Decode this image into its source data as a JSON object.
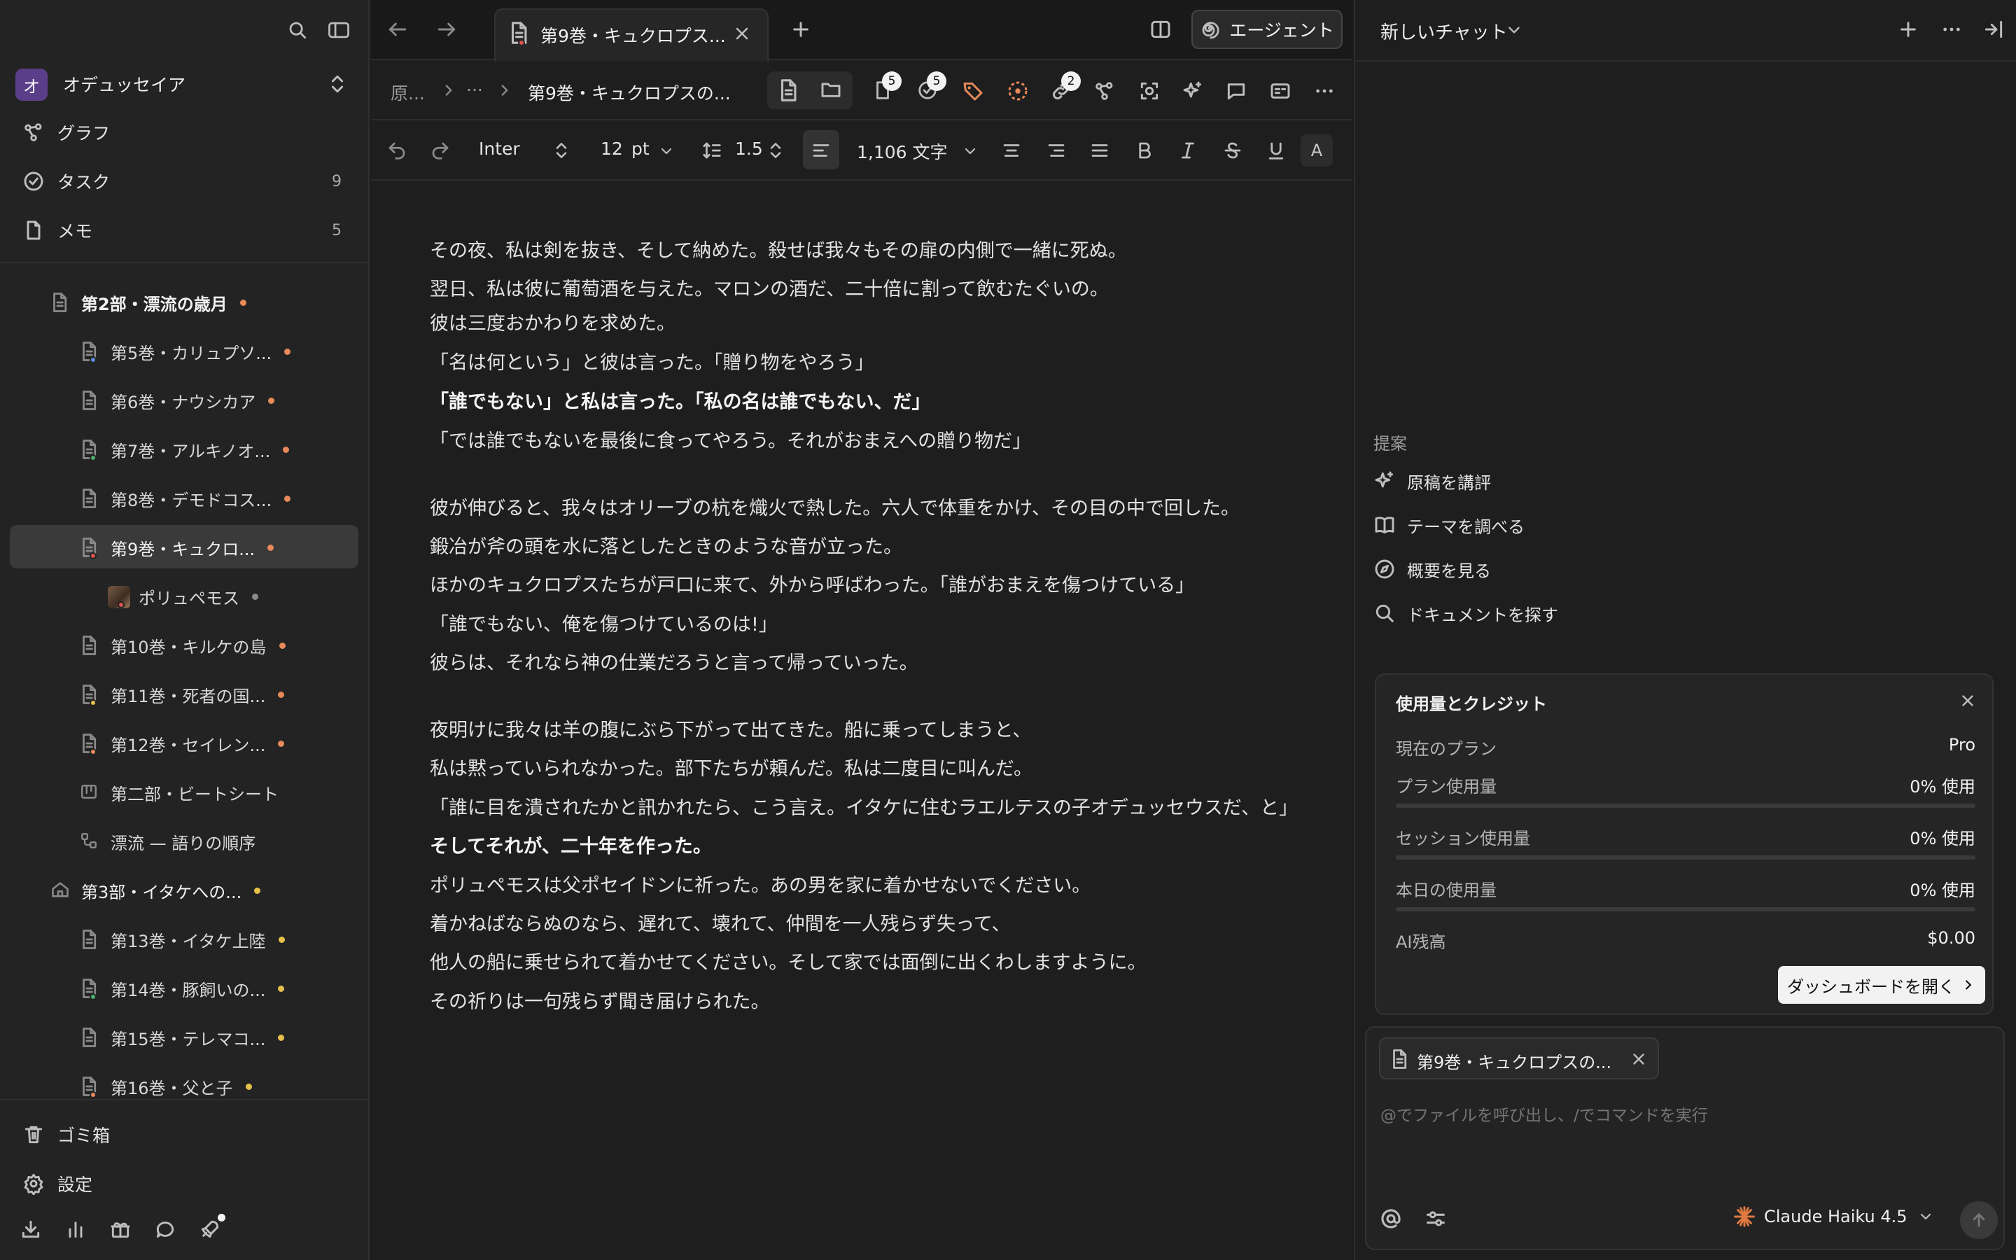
{
  "sidebar": {
    "workspace_initial": "オ",
    "workspace_name": "オデュッセイア",
    "nav": [
      {
        "label": "グラフ",
        "icon": "graph-icon",
        "count": ""
      },
      {
        "label": "タスク",
        "icon": "check-circle-icon",
        "count": "9"
      },
      {
        "label": "メモ",
        "icon": "note-icon",
        "count": "5"
      }
    ],
    "tree": [
      {
        "label": "第2部・漂流の歳月",
        "indent": 1,
        "icon": "document-icon",
        "dot": "#e8895a",
        "sub": ""
      },
      {
        "label": "第5巻・カリュプソ...",
        "indent": 2,
        "icon": "document-icon",
        "dot": "#e8895a",
        "sub": "#5b8bd9"
      },
      {
        "label": "第6巻・ナウシカア",
        "indent": 2,
        "icon": "document-icon",
        "dot": "#e8895a",
        "sub": ""
      },
      {
        "label": "第7巻・アルキノオ...",
        "indent": 2,
        "icon": "document-icon",
        "dot": "#e8895a",
        "sub": "#4caf6a"
      },
      {
        "label": "第8巻・デモドコス...",
        "indent": 2,
        "icon": "document-icon",
        "dot": "#e8895a",
        "sub": ""
      },
      {
        "label": "第9巻・キュクロ...",
        "indent": 2,
        "icon": "document-icon",
        "dot": "#e8895a",
        "sub": "#d9534f",
        "selected": true
      },
      {
        "label": "ポリュペモス",
        "indent": 3,
        "icon": "avatar-icon",
        "dot": "#8a8a8a",
        "sub": "#d9534f"
      },
      {
        "label": "第10巻・キルケの島",
        "indent": 2,
        "icon": "document-icon",
        "dot": "#e8895a",
        "sub": ""
      },
      {
        "label": "第11巻・死者の国...",
        "indent": 2,
        "icon": "document-icon",
        "dot": "#e8895a",
        "sub": "#e6c04a"
      },
      {
        "label": "第12巻・セイレン...",
        "indent": 2,
        "icon": "document-icon",
        "dot": "#e8895a",
        "sub": "#e8895a"
      },
      {
        "label": "第二部・ビートシート",
        "indent": 2,
        "icon": "board-icon",
        "dot": "",
        "sub": ""
      },
      {
        "label": "漂流 — 語りの順序",
        "indent": 2,
        "icon": "flow-icon",
        "dot": "",
        "sub": ""
      },
      {
        "label": "第3部・イタケへの...",
        "indent": 1,
        "icon": "home-icon",
        "dot": "#e6c04a",
        "sub": ""
      },
      {
        "label": "第13巻・イタケ上陸",
        "indent": 2,
        "icon": "document-icon",
        "dot": "#e6c04a",
        "sub": ""
      },
      {
        "label": "第14巻・豚飼いの...",
        "indent": 2,
        "icon": "document-icon",
        "dot": "#e6c04a",
        "sub": "#4caf6a"
      },
      {
        "label": "第15巻・テレマコ...",
        "indent": 2,
        "icon": "document-icon",
        "dot": "#e6c04a",
        "sub": ""
      },
      {
        "label": "第16巻・父と子",
        "indent": 2,
        "icon": "document-icon",
        "dot": "#e6c04a",
        "sub": "#e8895a"
      }
    ],
    "footer": [
      {
        "label": "ゴミ箱",
        "icon": "trash-icon"
      },
      {
        "label": "設定",
        "icon": "gear-icon"
      }
    ]
  },
  "editor": {
    "tab_title": "第9巻・キュクロプス...",
    "agent_label": "エージェント",
    "breadcrumb": {
      "root": "原...",
      "ellipsis": "···",
      "current": "第9巻・キュクロプスの..."
    },
    "badges": {
      "files": "5",
      "tasks": "5",
      "links": "2"
    },
    "format": {
      "font": "Inter",
      "size": "12",
      "unit": "pt",
      "line_height": "1.5",
      "word_count": "1,106 文字"
    },
    "paragraphs": [
      {
        "text": "その夜、私は剣を抜き、そして納めた。殺せば我々もその扉の内側で一緒に死ぬ。",
        "bold": false
      },
      {
        "text": "翌日、私は彼に葡萄酒を与えた。マロンの酒だ、二十倍に割って飲むたぐいの。",
        "bold": false
      },
      {
        "text": "彼は三度おかわりを求めた。",
        "bold": false
      },
      {
        "text": "「名は何という」と彼は言った。「贈り物をやろう」",
        "bold": false
      },
      {
        "text": "「誰でもない」と私は言った。「私の名は誰でもない、だ」",
        "bold": true
      },
      {
        "text": "「では誰でもないを最後に食ってやろう。それがおまえへの贈り物だ」",
        "bold": false
      },
      {
        "text": "彼が伸びると、我々はオリーブの杭を熾火で熱した。六人で体重をかけ、その目の中で回した。",
        "bold": false
      },
      {
        "text": "鍛冶が斧の頭を水に落としたときのような音が立った。",
        "bold": false
      },
      {
        "text": "ほかのキュクロプスたちが戸口に来て、外から呼ばわった。「誰がおまえを傷つけている」",
        "bold": false
      },
      {
        "text": "「誰でもない、俺を傷つけているのは!」",
        "bold": false
      },
      {
        "text": "彼らは、それなら神の仕業だろうと言って帰っていった。",
        "bold": false
      },
      {
        "text": "夜明けに我々は羊の腹にぶら下がって出てきた。船に乗ってしまうと、",
        "bold": false
      },
      {
        "text": "私は黙っていられなかった。部下たちが頼んだ。私は二度目に叫んだ。",
        "bold": false
      },
      {
        "text": "「誰に目を潰されたかと訊かれたら、こう言え。イタケに住むラエルテスの子オデュッセウスだ、と」",
        "bold": false
      },
      {
        "text": "そしてそれが、二十年を作った。",
        "bold": true
      },
      {
        "text": "ポリュペモスは父ポセイドンに祈った。あの男を家に着かせないでください。",
        "bold": false
      },
      {
        "text": "着かねばならぬのなら、遅れて、壊れて、仲間を一人残らず失って、",
        "bold": false
      },
      {
        "text": "他人の船に乗せられて着かせてください。そして家では面倒に出くわしますように。",
        "bold": false
      },
      {
        "text": "その祈りは一句残らず聞き届けられた。",
        "bold": false
      }
    ]
  },
  "chat": {
    "title": "新しいチャット",
    "suggestions_heading": "提案",
    "suggestions": [
      {
        "label": "原稿を講評",
        "icon": "sparkle-icon"
      },
      {
        "label": "テーマを調べる",
        "icon": "book-icon"
      },
      {
        "label": "概要を見る",
        "icon": "compass-icon"
      },
      {
        "label": "ドキュメントを探す",
        "icon": "search-icon"
      }
    ],
    "usage": {
      "title": "使用量とクレジット",
      "rows": [
        {
          "label": "現在のプラン",
          "value": "Pro"
        },
        {
          "label": "プラン使用量",
          "value": "0% 使用",
          "percent": 0
        },
        {
          "label": "セッション使用量",
          "value": "0% 使用",
          "percent": 0
        },
        {
          "label": "本日の使用量",
          "value": "0% 使用",
          "percent": 0
        },
        {
          "label": "AI残高",
          "value": "$0.00"
        }
      ],
      "dashboard_label": "ダッシュボードを開く"
    },
    "context_chip": "第9巻・キュクロプスの...",
    "input_placeholder": "@でファイルを呼び出し、/でコマンドを実行",
    "model": "Claude Haiku 4.5"
  },
  "colors": {
    "accent_orange": "#e8895a",
    "accent_yellow": "#e6c04a",
    "model_star": "#e07a3f"
  }
}
